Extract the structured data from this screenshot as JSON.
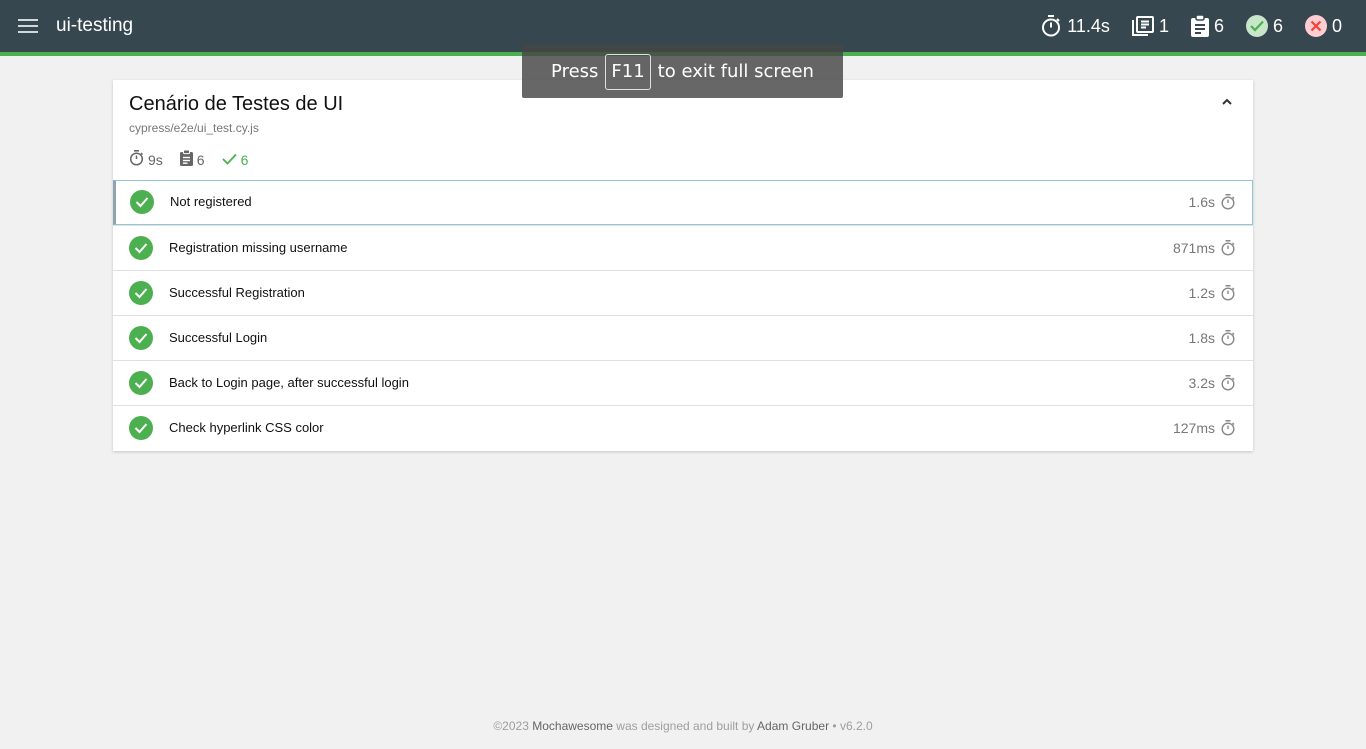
{
  "navbar": {
    "title": "ui-testing",
    "stats": {
      "duration": "11.4s",
      "suites": "1",
      "tests": "6",
      "passed": "6",
      "failed": "0"
    }
  },
  "fullscreen_toast": {
    "press": "Press",
    "key": "F11",
    "rest": "to exit full screen"
  },
  "suite": {
    "title": "Cenário de Testes de UI",
    "file": "cypress/e2e/ui_test.cy.js",
    "summary": {
      "duration": "9s",
      "tests": "6",
      "passed": "6"
    },
    "tests": [
      {
        "title": "Not registered",
        "duration": "1.6s"
      },
      {
        "title": "Registration missing username",
        "duration": "871ms"
      },
      {
        "title": "Successful Registration",
        "duration": "1.2s"
      },
      {
        "title": "Successful Login",
        "duration": "1.8s"
      },
      {
        "title": "Back to Login page, after successful login",
        "duration": "3.2s"
      },
      {
        "title": "Check hyperlink CSS color",
        "duration": "127ms"
      }
    ]
  },
  "footer": {
    "copyright": "©2023",
    "product": "Mochawesome",
    "middle": "was designed and built by",
    "author": "Adam Gruber",
    "version": "• v6.2.0"
  },
  "colors": {
    "navbar_bg": "#37474f",
    "accent_green": "#4caf50",
    "page_bg": "#f1f1f1"
  }
}
